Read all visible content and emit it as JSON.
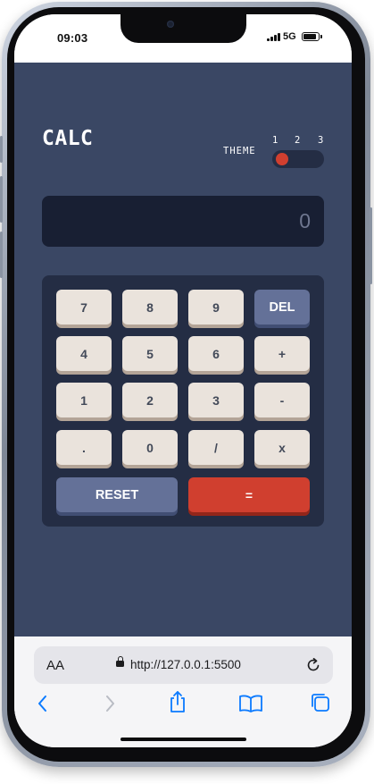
{
  "status": {
    "time": "09:03",
    "network": "5G"
  },
  "app": {
    "title": "CALC",
    "theme": {
      "label": "THEME",
      "options": [
        "1",
        "2",
        "3"
      ],
      "selected": 1
    },
    "display": "0",
    "keys": {
      "k7": "7",
      "k8": "8",
      "k9": "9",
      "del": "DEL",
      "k4": "4",
      "k5": "5",
      "k6": "6",
      "plus": "+",
      "k1": "1",
      "k2": "2",
      "k3": "3",
      "minus": "-",
      "dot": ".",
      "k0": "0",
      "divide": "/",
      "times": "x",
      "reset": "RESET",
      "equals": "="
    },
    "colors": {
      "background": "#3a4764",
      "keypad": "#242d44",
      "display": "#181f33",
      "key": "#eae3dc",
      "key_accent": "#647198",
      "equals": "#d03f2f"
    }
  },
  "browser": {
    "text_size_label": "AA",
    "url": "http://127.0.0.1:5500",
    "icons": [
      "back-icon",
      "forward-icon",
      "share-icon",
      "bookmarks-icon",
      "tabs-icon",
      "reload-icon",
      "lock-icon"
    ]
  }
}
